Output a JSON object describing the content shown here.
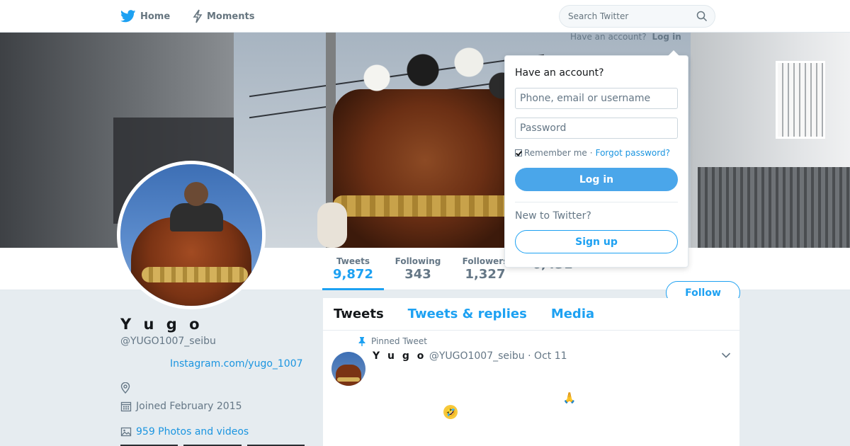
{
  "nav": {
    "home_label": "Home",
    "moments_label": "Moments",
    "search_placeholder": "Search Twitter"
  },
  "login_prompt": {
    "have_account": "Have an account?",
    "login_link": "Log in"
  },
  "login_dropdown": {
    "title": "Have an account?",
    "username_placeholder": "Phone, email or username",
    "password_placeholder": "Password",
    "remember_me": "Remember me",
    "separator": "·",
    "forgot_password": "Forgot password?",
    "login_button": "Log in",
    "new_to_twitter": "New to Twitter?",
    "signup_button": "Sign up"
  },
  "profile_nav": {
    "stats": [
      {
        "label": "Tweets",
        "value": "9,872"
      },
      {
        "label": "Following",
        "value": "343"
      },
      {
        "label": "Followers",
        "value": "1,327"
      },
      {
        "label": "",
        "value": "6,431"
      }
    ],
    "follow_button": "Follow"
  },
  "profile": {
    "name": "Y u g o",
    "handle": "@YUGO1007_seibu",
    "website": "Instagram.com/yugo_1007",
    "location": "",
    "joined": "Joined February 2015",
    "photos": "959 Photos and videos"
  },
  "timeline": {
    "tabs": [
      {
        "label": "Tweets"
      },
      {
        "label": "Tweets & replies"
      },
      {
        "label": "Media"
      }
    ],
    "pinned_label": "Pinned Tweet",
    "tweet": {
      "name": "Y u g o",
      "handle": "@YUGO1007_seibu",
      "separator": "·",
      "date": "Oct 11",
      "emoji_1": "🙏",
      "emoji_2": "🤣"
    }
  },
  "colors": {
    "brand": "#1da1f2",
    "link": "#1b95e0",
    "page_bg": "#e6ecf0"
  },
  "icons": [
    "twitter-bird-icon",
    "lightning-icon",
    "search-icon",
    "location-pin-icon",
    "calendar-icon",
    "image-icon",
    "pin-icon",
    "chevron-down-icon"
  ]
}
